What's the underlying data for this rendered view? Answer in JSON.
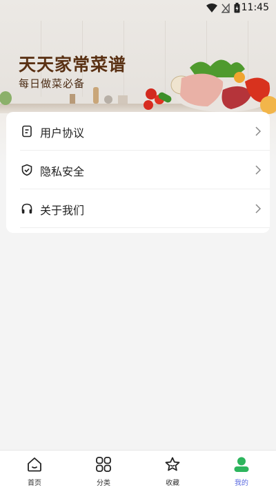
{
  "status": {
    "time": "11:45"
  },
  "header": {
    "title": "天天家常菜谱",
    "subtitle": "每日做菜必备"
  },
  "menu": {
    "items": [
      {
        "label": "用户协议",
        "icon": "document-icon"
      },
      {
        "label": "隐私安全",
        "icon": "shield-check-icon"
      },
      {
        "label": "关于我们",
        "icon": "headphones-icon"
      }
    ]
  },
  "tabbar": {
    "tabs": [
      {
        "label": "首页",
        "icon": "home-icon"
      },
      {
        "label": "分类",
        "icon": "grid-icon"
      },
      {
        "label": "收藏",
        "icon": "star-icon"
      },
      {
        "label": "我的",
        "icon": "user-icon",
        "active": true
      }
    ],
    "active_color": "#5b6be0"
  },
  "colors": {
    "title": "#5a3114",
    "avatar_green": "#2db55d"
  }
}
